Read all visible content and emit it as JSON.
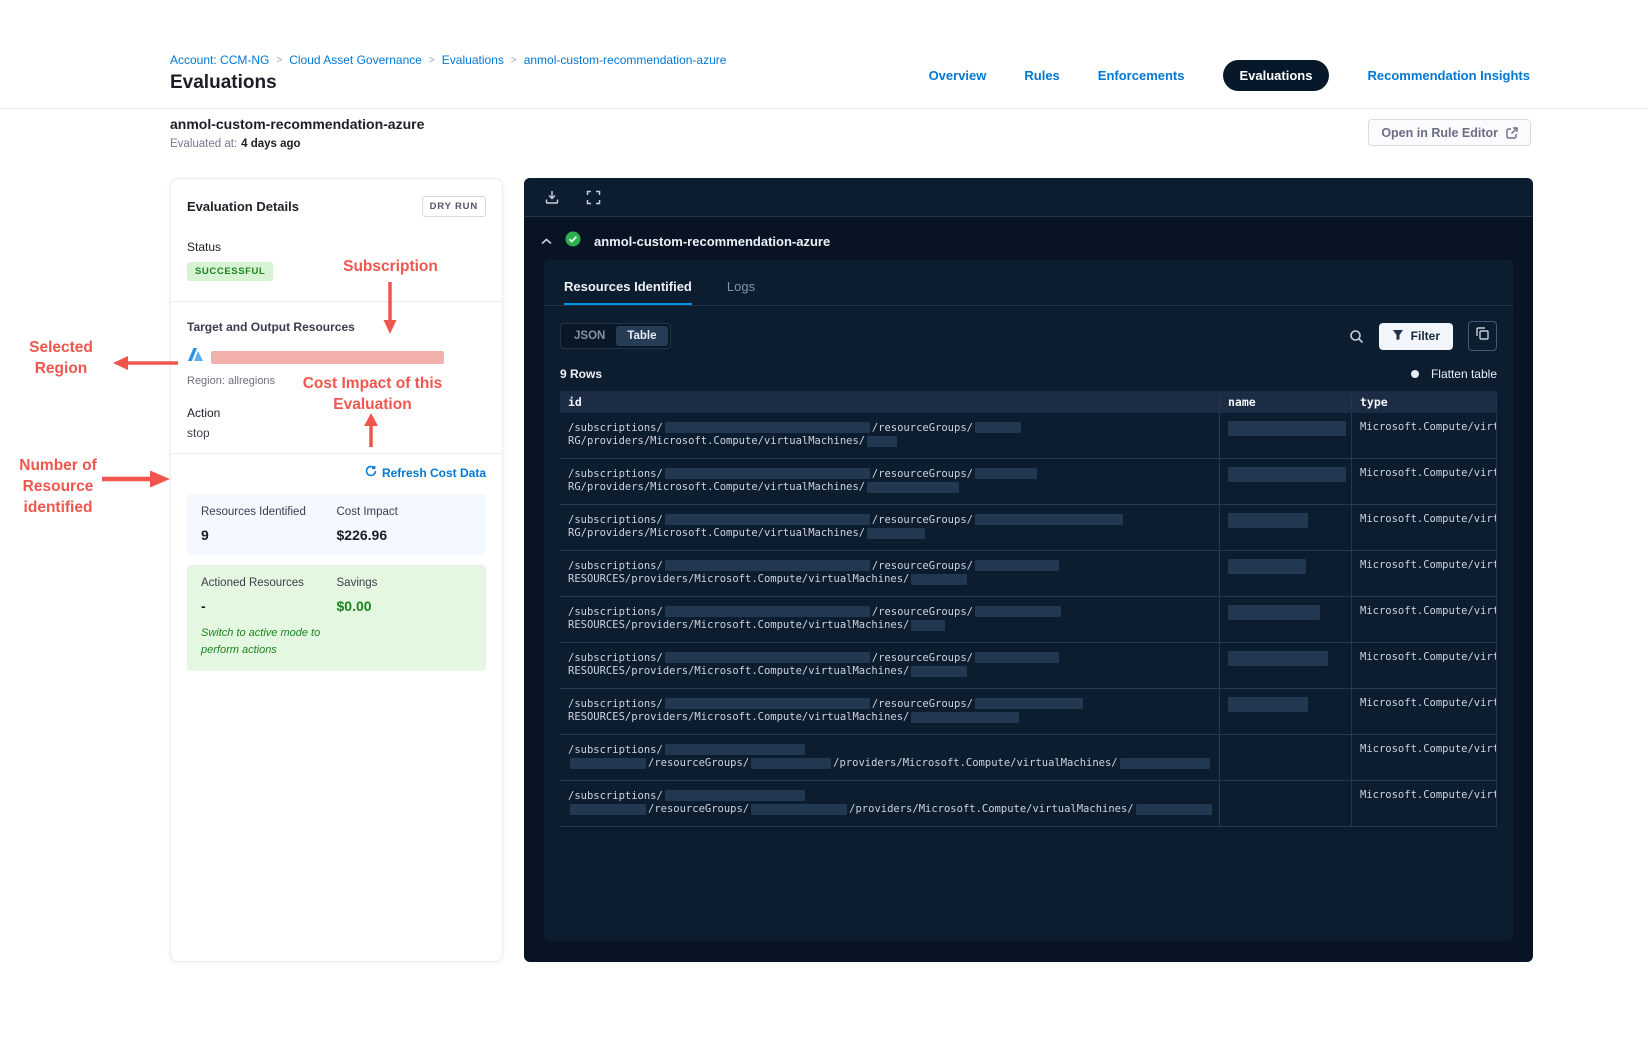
{
  "colors": {
    "accent_blue": "#0278d5",
    "navy": "#07182b",
    "red_annotation": "#f0564e",
    "green_text": "#1b841f",
    "green_badge_bg": "#d8f3d4",
    "redaction_pink": "#f2b1ac",
    "redaction_navy": "#223850"
  },
  "breadcrumb": {
    "items": [
      "Account: CCM-NG",
      "Cloud Asset Governance",
      "Evaluations",
      "anmol-custom-recommendation-azure"
    ]
  },
  "page": {
    "title": "Evaluations"
  },
  "nav": {
    "tabs": [
      {
        "label": "Overview",
        "active": false
      },
      {
        "label": "Rules",
        "active": false
      },
      {
        "label": "Enforcements",
        "active": false
      },
      {
        "label": "Evaluations",
        "active": true
      },
      {
        "label": "Recommendation Insights",
        "active": false
      }
    ]
  },
  "header": {
    "name": "anmol-custom-recommendation-azure",
    "evaluated_label": "Evaluated at:",
    "evaluated_value": "4 days ago",
    "open_rule_editor_label": "Open in Rule Editor"
  },
  "details": {
    "title": "Evaluation Details",
    "mode_badge": "DRY RUN",
    "status_label": "Status",
    "status_value": "SUCCESSFUL",
    "target_label": "Target and Output Resources",
    "region_line": "Region: allregions",
    "action_label": "Action",
    "action_value": "stop",
    "refresh_label": "Refresh Cost Data",
    "resources_identified_label": "Resources Identified",
    "resources_identified_value": "9",
    "cost_impact_label": "Cost Impact",
    "cost_impact_value": "$226.96",
    "actioned_label": "Actioned Resources",
    "actioned_value": "-",
    "savings_label": "Savings",
    "savings_value": "$0.00",
    "active_mode_note": "Switch to active mode to perform actions"
  },
  "annotations": {
    "subscription": "Subscription",
    "selected_region": "Selected Region",
    "cost_impact": "Cost Impact of this Evaluation",
    "resource_count": "Number of Resource identified"
  },
  "results_panel": {
    "title": "anmol-custom-recommendation-azure",
    "tabs": [
      {
        "label": "Resources Identified",
        "active": true
      },
      {
        "label": "Logs",
        "active": false
      }
    ],
    "view_toggle": [
      {
        "label": "JSON",
        "active": false
      },
      {
        "label": "Table",
        "active": true
      }
    ],
    "filter_label": "Filter",
    "row_count": "9 Rows",
    "flatten_label": "Flatten table",
    "table": {
      "columns": [
        "id",
        "name",
        "type"
      ],
      "rows": [
        {
          "id_line1": [
            {
              "t": "/subscriptions/"
            },
            {
              "b": 205
            },
            {
              "t": "/resourceGroups/"
            },
            {
              "b": 46
            }
          ],
          "id_line2": [
            {
              "t": "RG/providers/Microsoft.Compute/virtualMachines/"
            },
            {
              "b": 30
            }
          ],
          "name_block": 118,
          "type": "Microsoft.Compute/virtu"
        },
        {
          "id_line1": [
            {
              "t": "/subscriptions/"
            },
            {
              "b": 205
            },
            {
              "t": "/resourceGroups/"
            },
            {
              "b": 62
            }
          ],
          "id_line2": [
            {
              "t": "RG/providers/Microsoft.Compute/virtualMachines/"
            },
            {
              "b": 92
            }
          ],
          "name_block": 118,
          "type": "Microsoft.Compute/virtu"
        },
        {
          "id_line1": [
            {
              "t": "/subscriptions/"
            },
            {
              "b": 205
            },
            {
              "t": "/resourceGroups/"
            },
            {
              "b": 148
            }
          ],
          "id_line2": [
            {
              "t": "RG/providers/Microsoft.Compute/virtualMachines/"
            },
            {
              "b": 58
            }
          ],
          "name_block": 80,
          "type": "Microsoft.Compute/virtu"
        },
        {
          "id_line1": [
            {
              "t": "/subscriptions/"
            },
            {
              "b": 205
            },
            {
              "t": "/resourceGroups/"
            },
            {
              "b": 84
            }
          ],
          "id_line2": [
            {
              "t": "RESOURCES/providers/Microsoft.Compute/virtualMachines/"
            },
            {
              "b": 56
            }
          ],
          "name_block": 78,
          "type": "Microsoft.Compute/virtu"
        },
        {
          "id_line1": [
            {
              "t": "/subscriptions/"
            },
            {
              "b": 205
            },
            {
              "t": "/resourceGroups/"
            },
            {
              "b": 86
            }
          ],
          "id_line2": [
            {
              "t": "RESOURCES/providers/Microsoft.Compute/virtualMachines/"
            },
            {
              "b": 34
            }
          ],
          "name_block": 92,
          "type": "Microsoft.Compute/virtu"
        },
        {
          "id_line1": [
            {
              "t": "/subscriptions/"
            },
            {
              "b": 205
            },
            {
              "t": "/resourceGroups/"
            },
            {
              "b": 84
            }
          ],
          "id_line2": [
            {
              "t": "RESOURCES/providers/Microsoft.Compute/virtualMachines/"
            },
            {
              "b": 56
            }
          ],
          "name_block": 100,
          "type": "Microsoft.Compute/virtu"
        },
        {
          "id_line1": [
            {
              "t": "/subscriptions/"
            },
            {
              "b": 205
            },
            {
              "t": "/resourceGroups/"
            },
            {
              "b": 108
            }
          ],
          "id_line2": [
            {
              "t": "RESOURCES/providers/Microsoft.Compute/virtualMachines/"
            },
            {
              "b": 108
            }
          ],
          "name_block": 80,
          "type": "Microsoft.Compute/virtu"
        },
        {
          "id_line1": [
            {
              "t": "/subscriptions/"
            },
            {
              "b": 140
            }
          ],
          "id_line2": [
            {
              "b": 76
            },
            {
              "t": "/resourceGroups/"
            },
            {
              "b": 80
            },
            {
              "t": "/providers/Microsoft.Compute/virtualMachines/"
            },
            {
              "b": 90
            }
          ],
          "name_block": 0,
          "type": "Microsoft.Compute/virtu"
        },
        {
          "id_line1": [
            {
              "t": "/subscriptions/"
            },
            {
              "b": 140
            }
          ],
          "id_line2": [
            {
              "b": 76
            },
            {
              "t": "/resourceGroups/"
            },
            {
              "b": 96
            },
            {
              "t": "/providers/Microsoft.Compute/virtualMachines/"
            },
            {
              "b": 76
            }
          ],
          "name_block": 0,
          "type": "Microsoft.Compute/virtu"
        }
      ]
    }
  }
}
